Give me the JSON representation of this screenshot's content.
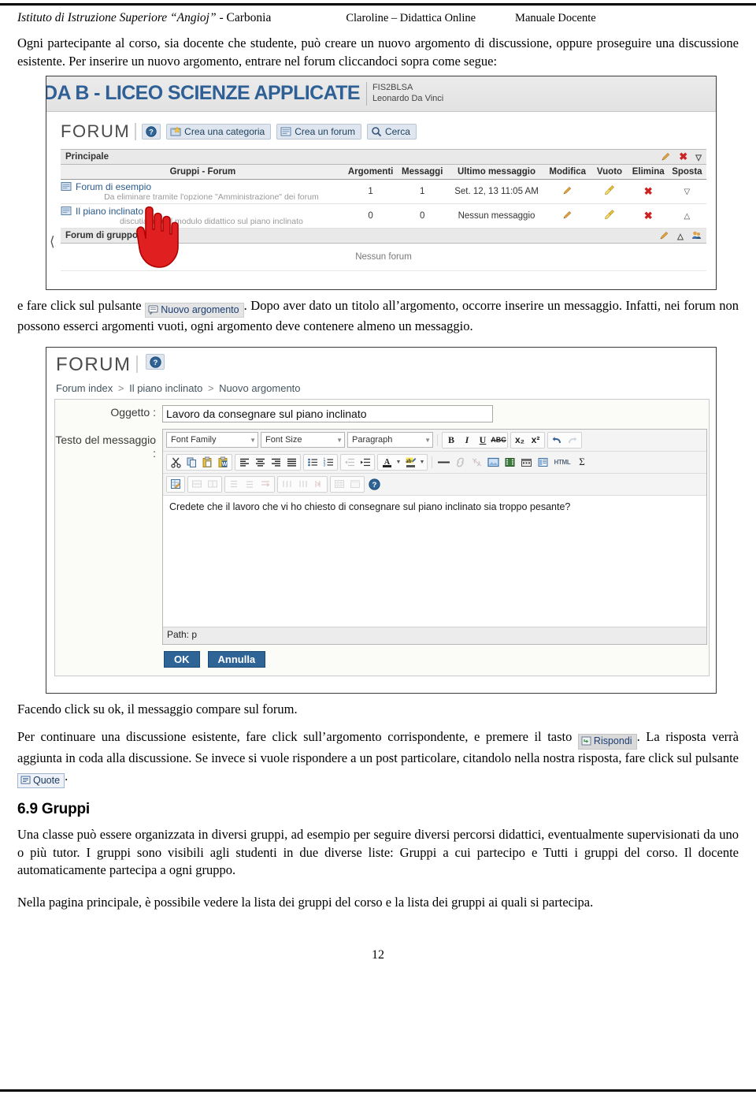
{
  "header": {
    "left_italic": "Istituto di Istruzione Superiore “Angioj”",
    "left_plain": " - Carbonia",
    "middle": "Claroline – Didattica Online",
    "right": "Manuale Docente"
  },
  "paragraphs": {
    "p1": "Ogni partecipante al corso, sia docente che studente, può creare un nuovo argomento di discussione, oppure proseguire una discussione esistente. Per inserire un nuovo argomento, entrare nel forum cliccandoci sopra come segue:",
    "p2_before": "e fare click sul pulsante",
    "p2_after": ". Dopo aver dato un titolo all’argomento, occorre inserire un messaggio. Infatti, nei forum non possono esserci argomenti vuoti, ogni argomento deve contenere almeno un messaggio.",
    "p3": "Facendo click su ok, il messaggio compare sul forum.",
    "p4_before": "Per continuare una discussione esistente, fare click sull’argomento corrispondente, e premere il tasto",
    "p4_mid": ". La risposta verrà aggiunta in coda alla discussione. Se invece si vuole rispondere a un post particolare, citandolo nella nostra risposta, fare click sul pulsante",
    "p4_after": ".",
    "p5": "Una classe può essere organizzata in diversi gruppi, ad esempio per seguire diversi percorsi didattici, eventualmente supervisionati da uno o più tutor. I gruppi sono visibili agli studenti in due diverse liste: Gruppi a cui partecipo e Tutti i gruppi del corso. Il docente automaticamente partecipa a ogni gruppo.",
    "p6": "Nella pagina principale, è possibile vedere la lista dei gruppi del corso e la lista dei gruppi ai quali si partecipa."
  },
  "inline_buttons": {
    "nuovo_argomento": "Nuovo argomento",
    "rispondi": "Rispondi",
    "quote": "Quote"
  },
  "section": {
    "number_title": "6.9 Gruppi"
  },
  "screenshot_forum": {
    "banner": {
      "course_title": "DA B - LICEO SCIENZE APPLICATE",
      "code": "FIS2BLSA",
      "subtitle": "Leonardo Da Vinci"
    },
    "tool_title": "FORUM",
    "buttons": [
      {
        "label": "Crea una categoria",
        "icon": "new-folder-icon"
      },
      {
        "label": "Crea un forum",
        "icon": "new-forum-icon"
      },
      {
        "label": "Cerca",
        "icon": "search-icon"
      }
    ],
    "help_icon": "help-icon",
    "category_main": "Principale",
    "category_group": "Forum di gruppo",
    "columns": [
      "Gruppi - Forum",
      "Argomenti",
      "Messaggi",
      "Ultimo messaggio",
      "Modifica",
      "Vuoto",
      "Elimina",
      "Sposta"
    ],
    "rows": [
      {
        "name": "Forum di esempio",
        "description": "Da eliminare tramite l'opzione \"Amministrazione\" dei forum",
        "argomenti": "1",
        "messaggi": "1",
        "ultimo_messaggio": "Set. 12, 13 11:05 AM",
        "sposta": "down"
      },
      {
        "name": "Il piano inclinato",
        "description": "discutiamo del modulo didattico sul piano inclinato",
        "argomenti": "0",
        "messaggi": "0",
        "ultimo_messaggio": "Nessun messaggio",
        "sposta": "up"
      }
    ],
    "group_empty": "Nessun forum"
  },
  "screenshot_editor": {
    "tool_title": "FORUM",
    "breadcrumb": [
      "Forum index",
      "Il piano inclinato",
      "Nuovo argomento"
    ],
    "breadcrumb_separator": ">",
    "label_subject": "Oggetto :",
    "subject_value": "Lavoro da consegnare sul piano inclinato",
    "label_message": "Testo del messaggio :",
    "toolbar_selects": [
      "Font Family",
      "Font Size",
      "Paragraph"
    ],
    "toolbar_format": [
      "B",
      "I",
      "U",
      "ABC",
      "x₂",
      "x²"
    ],
    "toolbar_icons_row1_names": [
      "bold-icon",
      "italic-icon",
      "underline-icon",
      "strikethrough-icon",
      "subscript-icon",
      "superscript-icon",
      "undo-icon",
      "redo-icon"
    ],
    "toolbar_icons_row2_names": [
      "cut-icon",
      "copy-icon",
      "paste-icon",
      "paste-word-icon",
      "align-left-icon",
      "align-center-icon",
      "align-right-icon",
      "align-justify-icon",
      "bullet-list-icon",
      "numbered-list-icon",
      "outdent-icon",
      "indent-icon",
      "text-color-icon",
      "background-color-icon",
      "horizontal-rule-icon",
      "link-icon",
      "unlink-icon",
      "image-icon",
      "media-icon",
      "anchor-icon",
      "template-icon",
      "html-icon",
      "special-char-icon"
    ],
    "toolbar_icons_row3_names": [
      "edit-table-icon",
      "delete-row-icon",
      "delete-col-icon",
      "insert-row-before-icon",
      "insert-row-after-icon",
      "merge-cells-icon",
      "split-cells-icon",
      "insert-col-before-icon",
      "insert-col-after-icon",
      "table-props-icon",
      "row-props-icon",
      "help-icon"
    ],
    "html_button_label": "HTML",
    "message_text": "Credete che il lavoro che vi ho chiesto di consegnare sul piano inclinato sia troppo pesante?",
    "path_bar": "Path: p",
    "ok_label": "OK",
    "cancel_label": "Annulla"
  },
  "page_number": "12",
  "colors": {
    "link_blue": "#2a5a8c",
    "banner_blue": "#2e6096",
    "button_blue": "#2f6496",
    "cursor_red": "#e02020",
    "delete_red": "#cc2222",
    "pencil_orange": "#e8a33d"
  }
}
